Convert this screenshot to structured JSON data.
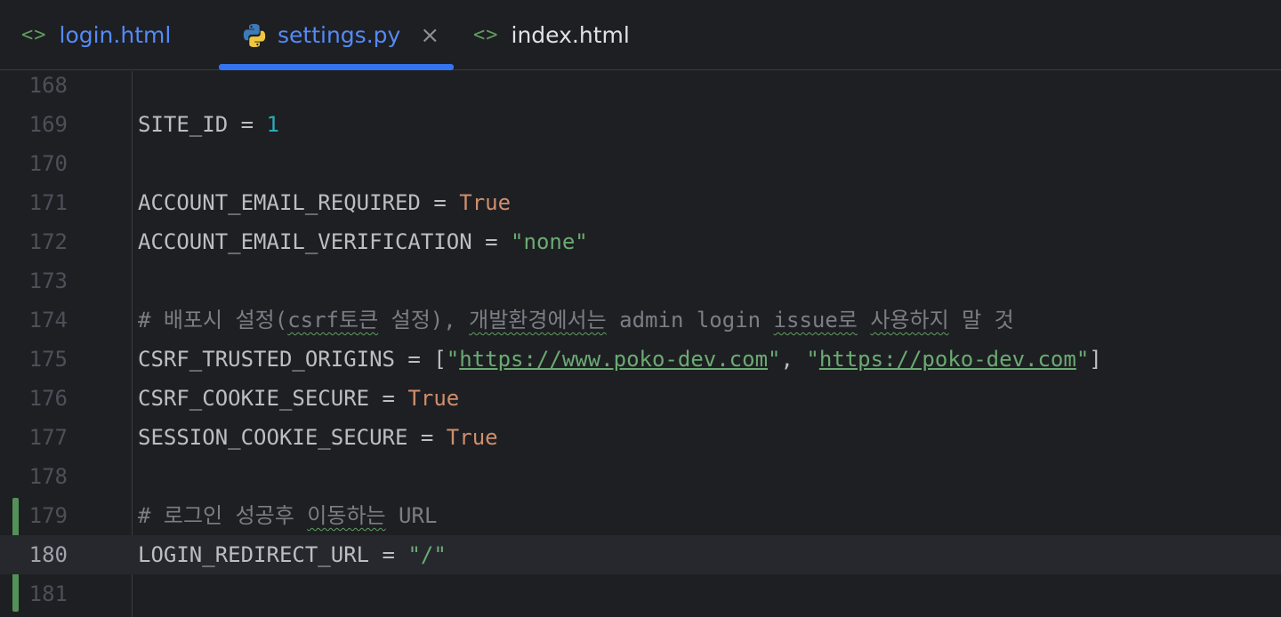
{
  "tabs": [
    {
      "label": "login.html",
      "icon": "html-file-icon",
      "icon_text": "<>"
    },
    {
      "label": "settings.py",
      "icon": "python-file-icon",
      "close_text": "×"
    },
    {
      "label": "index.html",
      "icon": "html-file-icon",
      "icon_text": "<>"
    }
  ],
  "active_tab": "settings.py",
  "current_line": "180",
  "lines": [
    {
      "num": "168",
      "code": ""
    },
    {
      "num": "169",
      "name": "SITE_ID",
      "op": " = ",
      "value": "1"
    },
    {
      "num": "170",
      "code": ""
    },
    {
      "num": "171",
      "name": "ACCOUNT_EMAIL_REQUIRED",
      "op": " = ",
      "value": "True"
    },
    {
      "num": "172",
      "name": "ACCOUNT_EMAIL_VERIFICATION",
      "op": " = ",
      "value": "\"none\""
    },
    {
      "num": "173",
      "code": ""
    },
    {
      "num": "174",
      "comment_a": "# 배포시 설정(",
      "comment_b": "csrf토큰",
      "comment_c": " 설정), ",
      "comment_d": "개발환경에서는",
      "comment_e": " admin login ",
      "comment_f": "issue로",
      "comment_g": " ",
      "comment_h": "사용하지",
      "comment_i": " 말 것"
    },
    {
      "num": "175",
      "name": "CSRF_TRUSTED_ORIGINS",
      "op": " = [",
      "q1": "\"",
      "url1": "https://www.poko-dev.com",
      "q2": "\"",
      "sep": ", ",
      "q3": "\"",
      "url2": "https://poko-dev.com",
      "q4": "\"",
      "end": "]"
    },
    {
      "num": "176",
      "name": "CSRF_COOKIE_SECURE",
      "op": " = ",
      "value": "True"
    },
    {
      "num": "177",
      "name": "SESSION_COOKIE_SECURE",
      "op": " = ",
      "value": "True"
    },
    {
      "num": "178",
      "code": ""
    },
    {
      "num": "179",
      "comment_a": "# 로그인 성공후 ",
      "comment_b": "이동하는",
      "comment_c": " URL"
    },
    {
      "num": "180",
      "name": "LOGIN_REDIRECT_URL",
      "op": " = ",
      "value": "\"/\""
    },
    {
      "num": "181",
      "code": ""
    }
  ],
  "colors": {
    "background": "#1e1f22",
    "accent": "#3574f0",
    "keyword": "#cf8e6d",
    "string": "#6aab73",
    "number": "#2aacb8",
    "comment": "#7a7e85",
    "vcs_added": "#549159"
  }
}
